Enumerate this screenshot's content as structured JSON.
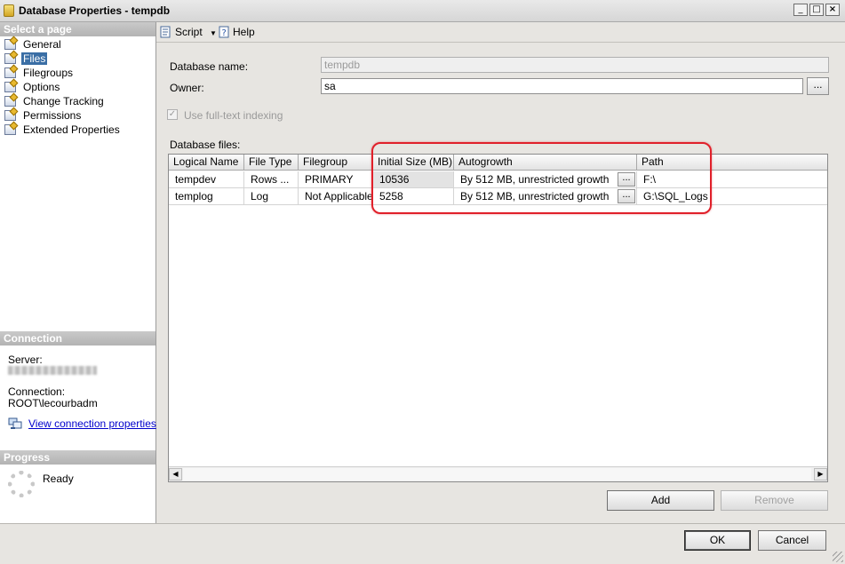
{
  "window": {
    "title": "Database Properties - tempdb"
  },
  "left": {
    "select_page_header": "Select a page",
    "pages": [
      "General",
      "Files",
      "Filegroups",
      "Options",
      "Change Tracking",
      "Permissions",
      "Extended Properties"
    ],
    "selected_page": "Files",
    "connection_header": "Connection",
    "server_label": "Server:",
    "connection_label": "Connection:",
    "connection_value": "ROOT\\lecourbadm",
    "view_link": "View connection properties",
    "progress_header": "Progress",
    "progress_status": "Ready"
  },
  "toolbar": {
    "script": "Script",
    "help": "Help"
  },
  "form": {
    "dbname_label": "Database name:",
    "dbname_value": "tempdb",
    "owner_label": "Owner:",
    "owner_value": "sa",
    "browse": "...",
    "fulltext_label": "Use full-text indexing",
    "dbfiles_label": "Database files:"
  },
  "grid": {
    "columns": [
      "Logical Name",
      "File Type",
      "Filegroup",
      "Initial Size (MB)",
      "Autogrowth",
      "Path"
    ],
    "rows": [
      {
        "name": "tempdev",
        "type": "Rows ...",
        "filegroup": "PRIMARY",
        "size": "10536",
        "autogrowth": "By 512 MB, unrestricted growth",
        "path": "F:\\"
      },
      {
        "name": "templog",
        "type": "Log",
        "filegroup": "Not Applicable",
        "size": "5258",
        "autogrowth": "By 512 MB, unrestricted growth",
        "path": "G:\\SQL_Logs"
      }
    ],
    "ellipsis": "..."
  },
  "buttons": {
    "add": "Add",
    "remove": "Remove",
    "ok": "OK",
    "cancel": "Cancel"
  },
  "colors": {
    "highlight": "#e0202a",
    "selection": "#3a6ea5",
    "link": "#0000cc"
  }
}
